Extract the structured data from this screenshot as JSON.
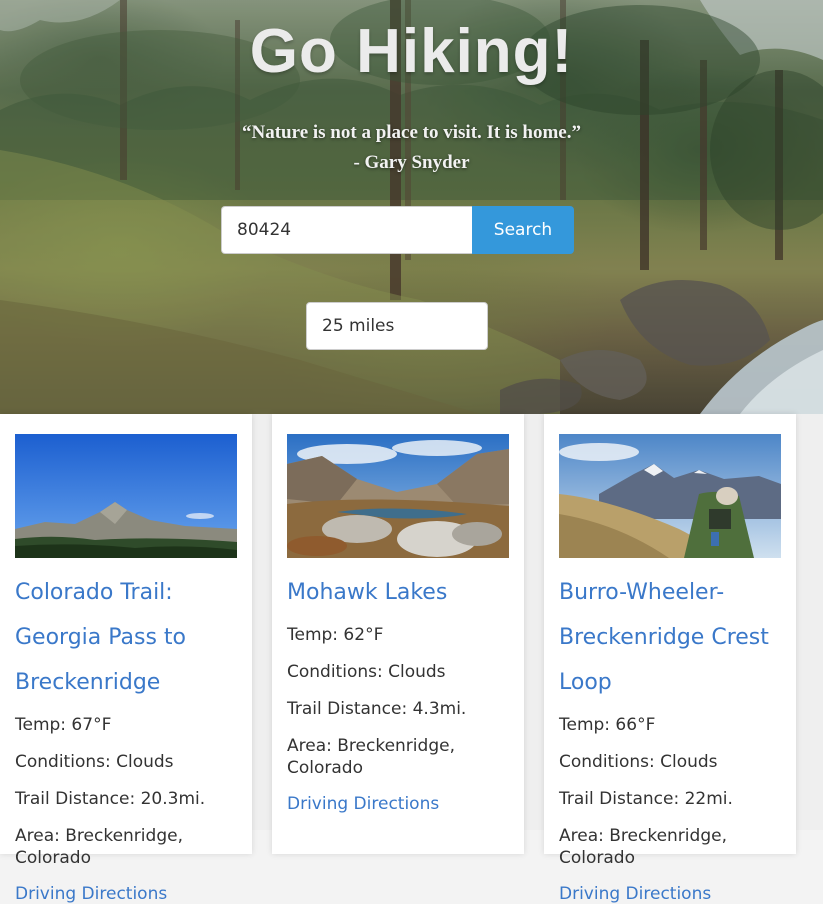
{
  "hero": {
    "title": "Go Hiking!",
    "quote": "“Nature is not a place to visit. It is home.”",
    "author": "- Gary Snyder"
  },
  "search": {
    "value": "80424",
    "button_label": "Search"
  },
  "radius": {
    "selected": "25 miles"
  },
  "trails": [
    {
      "name": "Colorado Trail: Georgia Pass to Breckenridge",
      "temp": "Temp: 67°F",
      "conditions": "Conditions: Clouds",
      "distance": "Trail Distance: 20.3mi.",
      "area": "Area: Breckenridge, Colorado",
      "directions": "Driving Directions"
    },
    {
      "name": "Mohawk Lakes",
      "temp": "Temp: 62°F",
      "conditions": "Conditions: Clouds",
      "distance": "Trail Distance: 4.3mi.",
      "area": "Area: Breckenridge, Colorado",
      "directions": "Driving Directions"
    },
    {
      "name": "Burro-Wheeler-Breckenridge Crest Loop",
      "temp": "Temp: 66°F",
      "conditions": "Conditions: Clouds",
      "distance": "Trail Distance: 22mi.",
      "area": "Area: Breckenridge, Colorado",
      "directions": "Driving Directions"
    }
  ],
  "colors": {
    "accent": "#3498db",
    "link": "#3a78c9"
  }
}
